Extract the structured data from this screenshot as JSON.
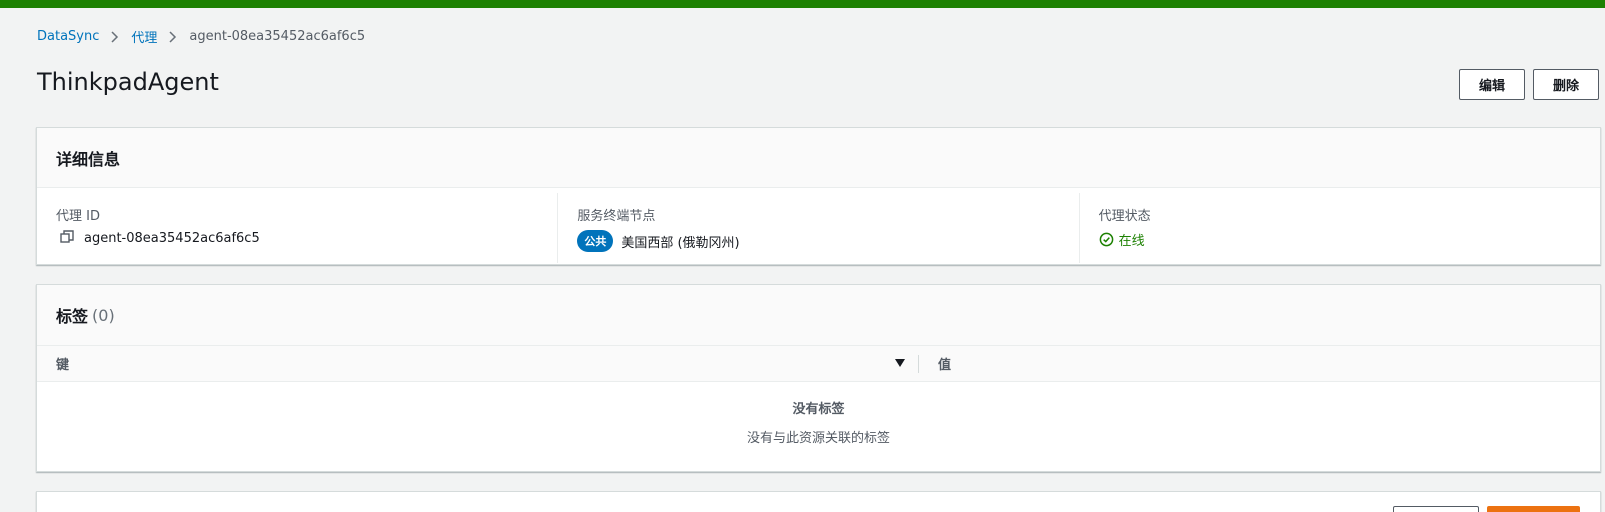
{
  "colors": {
    "topbar": "#1d8102",
    "link": "#0073bb",
    "status_ok": "#1d8102",
    "badge_bg": "#0073bb",
    "primary_button": "#ec7211"
  },
  "breadcrumb": {
    "items": [
      {
        "label": "DataSync"
      },
      {
        "label": "代理"
      }
    ],
    "current": "agent-08ea35452ac6af6c5"
  },
  "page": {
    "title": "ThinkpadAgent"
  },
  "actions": {
    "edit_label": "编辑",
    "delete_label": "删除"
  },
  "details": {
    "title": "详细信息",
    "agent_id_label": "代理 ID",
    "agent_id_value": "agent-08ea35452ac6af6c5",
    "agent_id_icon": "copy-icon",
    "endpoint_label": "服务终端节点",
    "endpoint_badge": "公共",
    "endpoint_value": "美国西部 (俄勒冈州)",
    "status_label": "代理状态",
    "status_value": "在线",
    "status_icon": "check-circle-icon"
  },
  "tags": {
    "title": "标签",
    "count": "(0)",
    "columns": {
      "key": "键",
      "value": "值"
    },
    "sort_icon": "caret-down-icon",
    "empty_title": "没有标签",
    "empty_description": "没有与此资源关联的标签"
  }
}
